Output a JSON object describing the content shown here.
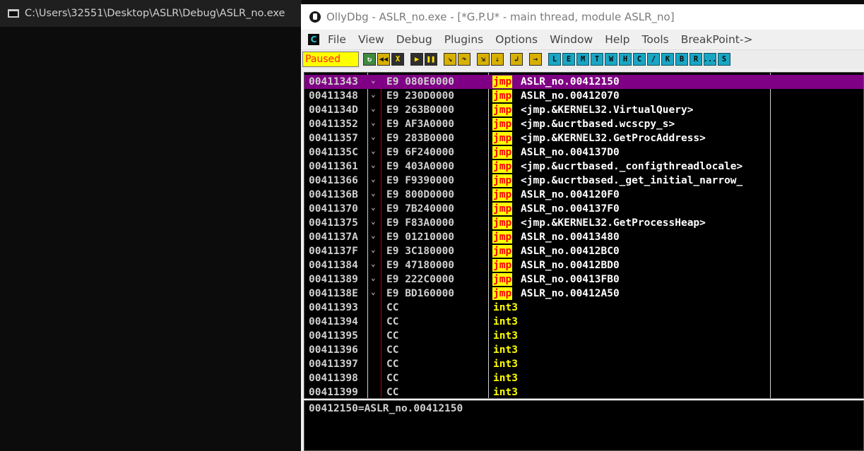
{
  "console": {
    "title": "C:\\Users\\32551\\Desktop\\ASLR\\Debug\\ASLR_no.exe"
  },
  "olly": {
    "title": "OllyDbg - ASLR_no.exe - [*G.P.U* - main thread, module ASLR_no]",
    "menu": [
      "File",
      "View",
      "Debug",
      "Plugins",
      "Options",
      "Window",
      "Help",
      "Tools",
      "BreakPoint->"
    ],
    "menu_icon_letter": "C",
    "toolbar": {
      "status": "Paused",
      "run_buttons": [
        {
          "name": "restart-icon",
          "glyph": "↻",
          "style": "green"
        },
        {
          "name": "close-program-icon",
          "glyph": "◀◀",
          "style": "yellow"
        },
        {
          "name": "stop-icon",
          "glyph": "X",
          "style": "dark"
        },
        {
          "name": "run-icon",
          "glyph": "▶",
          "style": "dark"
        },
        {
          "name": "pause-icon",
          "glyph": "❚❚",
          "style": "dark"
        },
        {
          "name": "step-into-icon",
          "glyph": "↘",
          "style": "yellow"
        },
        {
          "name": "step-over-icon",
          "glyph": "↷",
          "style": "yellow"
        },
        {
          "name": "trace-into-icon",
          "glyph": "⇲",
          "style": "yellow"
        },
        {
          "name": "trace-over-icon",
          "glyph": "⇣",
          "style": "yellow"
        },
        {
          "name": "execute-till-return-icon",
          "glyph": "↲",
          "style": "yellow"
        },
        {
          "name": "goto-icon",
          "glyph": "→",
          "style": "yellow"
        }
      ],
      "window_buttons": [
        "L",
        "E",
        "M",
        "T",
        "W",
        "H",
        "C",
        "/",
        "K",
        "B",
        "R",
        "...",
        "S"
      ]
    },
    "disasm_rows": [
      {
        "addr": "00411343",
        "hex": "E9 080E0000",
        "mnemonic": "jmp",
        "operand": "ASLR_no.00412150",
        "selected": true
      },
      {
        "addr": "00411348",
        "hex": "E9 230D0000",
        "mnemonic": "jmp",
        "operand": "ASLR_no.00412070"
      },
      {
        "addr": "0041134D",
        "hex": "E9 263B0000",
        "mnemonic": "jmp",
        "operand": "<jmp.&KERNEL32.VirtualQuery>"
      },
      {
        "addr": "00411352",
        "hex": "E9 AF3A0000",
        "mnemonic": "jmp",
        "operand": "<jmp.&ucrtbased.wcscpy_s>"
      },
      {
        "addr": "00411357",
        "hex": "E9 283B0000",
        "mnemonic": "jmp",
        "operand": "<jmp.&KERNEL32.GetProcAddress>"
      },
      {
        "addr": "0041135C",
        "hex": "E9 6F240000",
        "mnemonic": "jmp",
        "operand": "ASLR_no.004137D0"
      },
      {
        "addr": "00411361",
        "hex": "E9 403A0000",
        "mnemonic": "jmp",
        "operand": "<jmp.&ucrtbased._configthreadlocale>"
      },
      {
        "addr": "00411366",
        "hex": "E9 F9390000",
        "mnemonic": "jmp",
        "operand": "<jmp.&ucrtbased._get_initial_narrow_"
      },
      {
        "addr": "0041136B",
        "hex": "E9 800D0000",
        "mnemonic": "jmp",
        "operand": "ASLR_no.004120F0"
      },
      {
        "addr": "00411370",
        "hex": "E9 7B240000",
        "mnemonic": "jmp",
        "operand": "ASLR_no.004137F0"
      },
      {
        "addr": "00411375",
        "hex": "E9 F83A0000",
        "mnemonic": "jmp",
        "operand": "<jmp.&KERNEL32.GetProcessHeap>"
      },
      {
        "addr": "0041137A",
        "hex": "E9 01210000",
        "mnemonic": "jmp",
        "operand": "ASLR_no.00413480"
      },
      {
        "addr": "0041137F",
        "hex": "E9 3C180000",
        "mnemonic": "jmp",
        "operand": "ASLR_no.00412BC0"
      },
      {
        "addr": "00411384",
        "hex": "E9 47180000",
        "mnemonic": "jmp",
        "operand": "ASLR_no.00412BD0"
      },
      {
        "addr": "00411389",
        "hex": "E9 222C0000",
        "mnemonic": "jmp",
        "operand": "ASLR_no.00413FB0"
      },
      {
        "addr": "0041138E",
        "hex": "E9 BD160000",
        "mnemonic": "jmp",
        "operand": "ASLR_no.00412A50"
      },
      {
        "addr": "00411393",
        "hex": "CC",
        "mnemonic": "int3",
        "operand": ""
      },
      {
        "addr": "00411394",
        "hex": "CC",
        "mnemonic": "int3",
        "operand": ""
      },
      {
        "addr": "00411395",
        "hex": "CC",
        "mnemonic": "int3",
        "operand": ""
      },
      {
        "addr": "00411396",
        "hex": "CC",
        "mnemonic": "int3",
        "operand": ""
      },
      {
        "addr": "00411397",
        "hex": "CC",
        "mnemonic": "int3",
        "operand": ""
      },
      {
        "addr": "00411398",
        "hex": "CC",
        "mnemonic": "int3",
        "operand": ""
      },
      {
        "addr": "00411399",
        "hex": "CC",
        "mnemonic": "int3",
        "operand": ""
      }
    ],
    "info_line": "00412150=ASLR_no.00412150"
  },
  "colors": {
    "selection": "#7f0084",
    "jmp_bg": "#ffff00",
    "jmp_fg": "#ff0000",
    "int3_fg": "#ffff00",
    "paused_bg": "#ffff00",
    "paused_fg": "#ff2020"
  }
}
